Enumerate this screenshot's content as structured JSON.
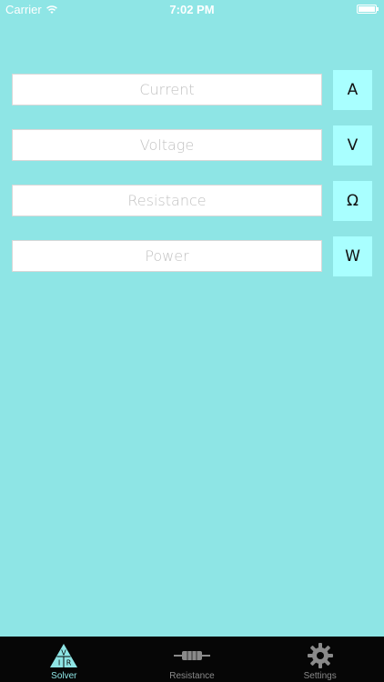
{
  "status_bar": {
    "carrier": "Carrier",
    "time": "7:02 PM"
  },
  "fields": [
    {
      "placeholder": "Current",
      "unit": "A"
    },
    {
      "placeholder": "Voltage",
      "unit": "V"
    },
    {
      "placeholder": "Resistance",
      "unit": "Ω"
    },
    {
      "placeholder": "Power",
      "unit": "W"
    }
  ],
  "tabs": [
    {
      "label": "Solver",
      "icon": "vir-triangle-icon",
      "active": true
    },
    {
      "label": "Resistance",
      "icon": "resistor-icon",
      "active": false
    },
    {
      "label": "Settings",
      "icon": "gear-icon",
      "active": false
    }
  ],
  "triangle_letters": {
    "top": "V",
    "left": "I",
    "right": "R"
  },
  "colors": {
    "background": "#8ee5e5",
    "unit_button": "#a9ffff",
    "tab_bar": "#060606",
    "tab_active": "#8ee5e5"
  }
}
